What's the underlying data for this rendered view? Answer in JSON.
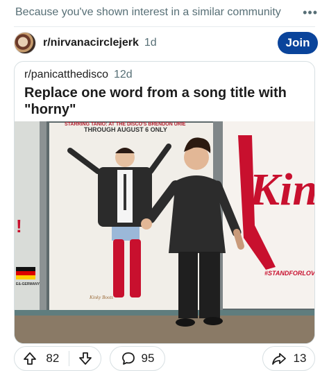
{
  "banner": {
    "text": "Because you've shown interest in a similar community",
    "more_icon": "more-dots-icon"
  },
  "post": {
    "subreddit": "r/nirvanacirclejerk",
    "age": "1d",
    "join_label": "Join"
  },
  "crosspost": {
    "subreddit": "r/panicatthedisco",
    "age": "12d",
    "title": "Replace one word from a song title with \"horny\""
  },
  "photo": {
    "poster_top_text": "STARRING TANIO: AT THE DISCO'S BRENDON URIE",
    "poster_date_text": "THROUGH AUGUST 6 ONLY",
    "hashtag_text": "#STANDFORLOVE",
    "germany_text": "E&-GERMANY",
    "signature_text": "Kinky Boots",
    "brand_letters": "Kin",
    "colors": {
      "boots_red": "#c8102e",
      "wall": "#f2f0ea",
      "floor": "#8a7a66"
    }
  },
  "actions": {
    "upvote_count": "82",
    "comment_count": "95",
    "share_count": "13"
  },
  "colors": {
    "accent": "#0a449b",
    "muted": "#576f76",
    "border": "#d7dfe2"
  }
}
